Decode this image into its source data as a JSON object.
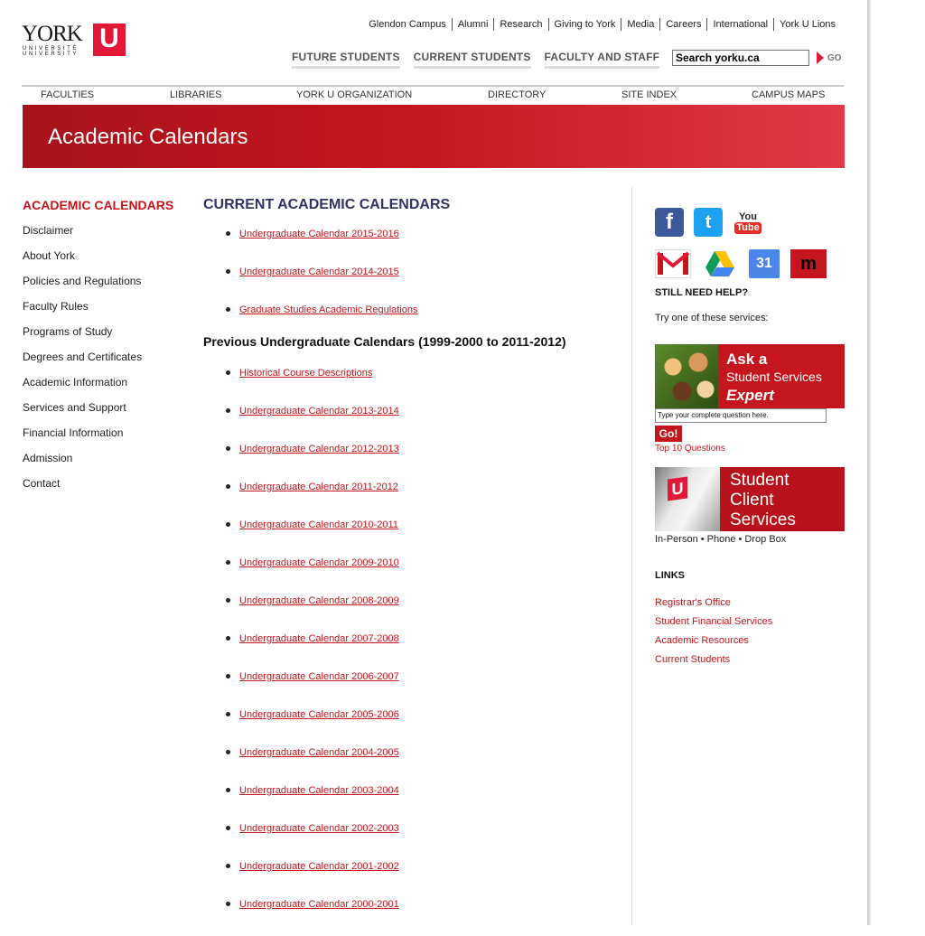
{
  "header": {
    "logo": {
      "york": "YORK",
      "universite": "UNIVERSITÉ",
      "university": "UNIVERSITY",
      "u": "U"
    },
    "top_links": [
      "Glendon Campus",
      "Alumni",
      "Research",
      "Giving to York",
      "Media",
      "Careers",
      "International",
      "York U Lions"
    ],
    "audience_links": [
      "FUTURE STUDENTS",
      "CURRENT STUDENTS",
      "FACULTY AND STAFF"
    ],
    "search_value": "Search yorku.ca",
    "go_label": "GO"
  },
  "main_nav": [
    "FACULTIES",
    "LIBRARIES",
    "YORK U ORGANIZATION",
    "DIRECTORY",
    "SITE INDEX",
    "CAMPUS MAPS"
  ],
  "banner_title": "Academic Calendars",
  "sidebar": {
    "title": "ACADEMIC CALENDARS",
    "items": [
      "Disclaimer",
      "About York",
      "Policies and Regulations",
      "Faculty Rules",
      "Programs of Study",
      "Degrees and Certificates",
      "Academic Information",
      "Services and Support",
      "Financial Information",
      "Admission",
      "Contact"
    ]
  },
  "main": {
    "current_heading": "CURRENT ACADEMIC CALENDARS",
    "current_links": [
      "Undergraduate Calendar 2015-2016",
      "Undergraduate Calendar 2014-2015",
      "Graduate Studies Academic Regulations"
    ],
    "previous_heading": "Previous Undergraduate Calendars (1999-2000 to 2011-2012)",
    "previous_links": [
      "Historical Course Descriptions",
      "Undergraduate Calendar 2013-2014",
      "Undergraduate Calendar 2012-2013",
      "Undergraduate Calendar 2011-2012",
      "Undergraduate Calendar 2010-2011",
      "Undergraduate Calendar 2009-2010",
      "Undergraduate Calendar 2008-2009",
      "Undergraduate Calendar 2007-2008",
      "Undergraduate Calendar 2006-2007",
      "Undergraduate Calendar 2005-2006",
      "Undergraduate Calendar 2004-2005",
      "Undergraduate Calendar 2003-2004",
      "Undergraduate Calendar 2002-2003",
      "Undergraduate Calendar 2001-2002",
      "Undergraduate Calendar 2000-2001"
    ]
  },
  "right": {
    "social_icons": {
      "facebook": "f",
      "twitter": "t",
      "youtube_you": "You",
      "youtube_tube": "Tube"
    },
    "app_icons": {
      "gmail": "gmail-icon",
      "drive": "google-drive-icon",
      "calendar": "31",
      "moodle": "m"
    },
    "help_heading": "STILL NEED HELP?",
    "help_text": "Try one of these services:",
    "ask_banner": {
      "line1": "Ask a",
      "line2": "Student Services",
      "line3": "Expert"
    },
    "question_placeholder": "Type your complete question here.",
    "question_go": "Go!",
    "top10": "Top 10 Questions",
    "scs_banner": {
      "line1": "Student",
      "line2": "Client",
      "line3": "Services",
      "u": "U"
    },
    "scs_sub": "In-Person • Phone • Drop Box",
    "links_heading": "LINKS",
    "links": [
      "Registrar's Office",
      "Student Financial Services",
      "Academic Resources",
      "Current Students"
    ]
  },
  "colors": {
    "brand_red": "#c4161c",
    "heading_blue": "#333366"
  }
}
